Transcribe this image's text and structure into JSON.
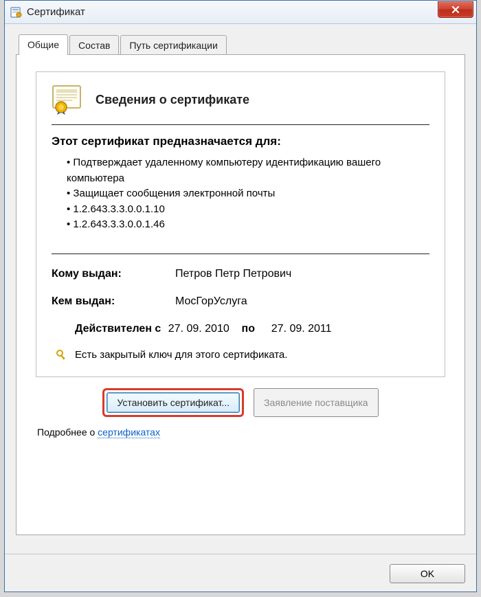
{
  "window": {
    "title": "Сертификат"
  },
  "tabs": {
    "general": "Общие",
    "details": "Состав",
    "path": "Путь сертификации"
  },
  "cert": {
    "info_title": "Сведения о сертификате",
    "purpose_heading": "Этот сертификат предназначается для:",
    "purposes": {
      "p0": "Подтверждает удаленному компьютеру идентификацию вашего компьютера",
      "p1": "Защищает сообщения электронной почты",
      "p2": "1.2.643.3.3.0.0.1.10",
      "p3": "1.2.643.3.3.0.0.1.46"
    },
    "issued_to_label": "Кому выдан:",
    "issued_to_value": "Петров Петр Петрович",
    "issued_by_label": "Кем выдан:",
    "issued_by_value": "МосГорУслуга",
    "valid_from_label": "Действителен с",
    "valid_from_value": "27. 09. 2010",
    "valid_to_label": "по",
    "valid_to_value": "27. 09. 2011",
    "private_key_note": "Есть закрытый ключ для этого сертификата."
  },
  "buttons": {
    "install": "Установить сертификат...",
    "issuer_statement": "Заявление поставщика",
    "ok": "OK"
  },
  "more": {
    "prefix": "Подробнее о ",
    "link": "сертификатах"
  }
}
